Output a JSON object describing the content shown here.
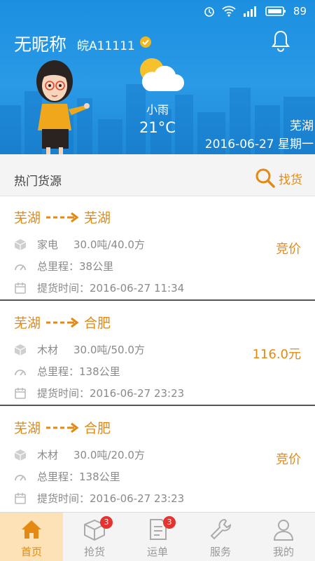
{
  "status_bar": {
    "battery": "89"
  },
  "header": {
    "nickname": "无昵称",
    "plate": "皖A11111",
    "weather": "小雨",
    "temperature": "21°C",
    "city": "芜湖",
    "date": "2016-06-27 星期一"
  },
  "section": {
    "title": "热门货源",
    "find_label": "找货"
  },
  "cards": [
    {
      "from": "芜湖",
      "to": "芜湖",
      "cargo": "家电",
      "capacity": "30.0吨/40.0方",
      "distance": "总里程：38公里",
      "pickup": "提货时间：2016-06-27 11:34",
      "price": "竞价"
    },
    {
      "from": "芜湖",
      "to": "合肥",
      "cargo": "木材",
      "capacity": "30.0吨/50.0方",
      "distance": "总里程：138公里",
      "pickup": "提货时间：2016-06-27 23:23",
      "price": "116.0元"
    },
    {
      "from": "芜湖",
      "to": "合肥",
      "cargo": "木材",
      "capacity": "30.0吨/20.0方",
      "distance": "总里程：138公里",
      "pickup": "提货时间：2016-06-27 23:23",
      "price": "竞价"
    }
  ],
  "tabs": [
    {
      "label": "首页",
      "icon": "home-icon",
      "badge": ""
    },
    {
      "label": "抢货",
      "icon": "box-icon",
      "badge": "3"
    },
    {
      "label": "运单",
      "icon": "document-icon",
      "badge": "3"
    },
    {
      "label": "服务",
      "icon": "wrench-icon",
      "badge": ""
    },
    {
      "label": "我的",
      "icon": "person-icon",
      "badge": ""
    }
  ],
  "colors": {
    "accent": "#e48a12",
    "header_blue": "#1c8fe0",
    "badge_red": "#e3342f"
  }
}
